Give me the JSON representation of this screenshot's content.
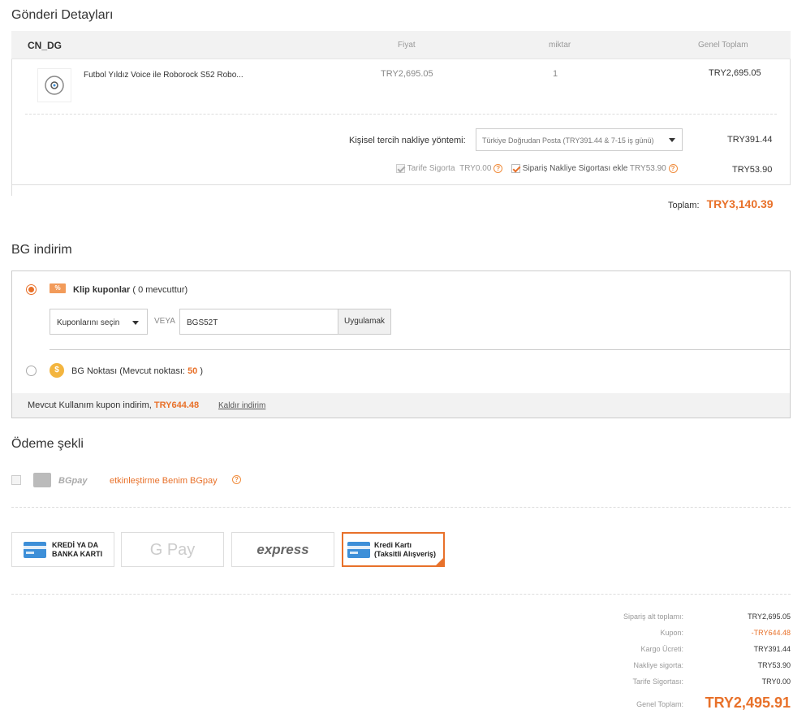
{
  "shipment": {
    "title": "Gönderi Detayları",
    "warehouse": "CN_DG",
    "col_price": "Fiyat",
    "col_qty": "miktar",
    "col_total": "Genel Toplam",
    "product": {
      "name": "Futbol Yıldız Voice ile Roborock S52 Robo...",
      "price": "TRY2,695.05",
      "qty": "1",
      "total": "TRY2,695.05"
    },
    "method_label": "Kişisel tercih nakliye yöntemi:",
    "method_value": "Türkiye Doğrudan Posta (TRY391.44 & 7-15 iş günü)",
    "method_cost": "TRY391.44",
    "tariff_label": "Tarife Sigorta",
    "tariff_amount": "TRY0.00",
    "shipping_ins_label": "Sipariş Nakliye Sigortası ekle",
    "shipping_ins_amount": "TRY53.90",
    "shipping_ins_cost": "TRY53.90",
    "total_label": "Toplam:",
    "total_amount": "TRY3,140.39"
  },
  "discount": {
    "title": "BG indirim",
    "coupon_label_prefix": "Klip kuponlar",
    "coupon_label_count": "( 0 mevcuttur)",
    "coupon_select": "Kuponlarını seçin",
    "or": "VEYA",
    "coupon_code": "BGS52T",
    "apply": "Uygulamak",
    "points_label": "BG Noktası (Mevcut noktası:",
    "points_value": "50",
    "points_close": ")",
    "current_label": "Mevcut Kullanım kupon indirim,",
    "current_amount": "TRY644.48",
    "remove": "Kaldır indirim"
  },
  "payment": {
    "title": "Ödeme şekli",
    "bgpay": "BGpay",
    "bgpay_activate": "etkinleştirme Benim BGpay",
    "options": [
      {
        "line1": "KREDİ YA DA",
        "line2": "BANKA KARTI"
      },
      {
        "label": "G Pay"
      },
      {
        "label": "express"
      },
      {
        "line1": "Kredi Kartı",
        "line2": "(Taksitli Alışveriş)"
      }
    ]
  },
  "summary": {
    "subtotal_label": "Sipariş alt toplamı:",
    "subtotal": "TRY2,695.05",
    "coupon_label": "Kupon:",
    "coupon": "-TRY644.48",
    "shipping_label": "Kargo Ücreti:",
    "shipping": "TRY391.44",
    "ship_ins_label": "Nakliye sigorta:",
    "ship_ins": "TRY53.90",
    "tariff_label": "Tarife Sigortası:",
    "tariff": "TRY0.00",
    "grand_label": "Genel Toplam:",
    "grand": "TRY2,495.91"
  },
  "colors": {
    "accent": "#e8712a",
    "card_blue": "#3d8fd8"
  }
}
